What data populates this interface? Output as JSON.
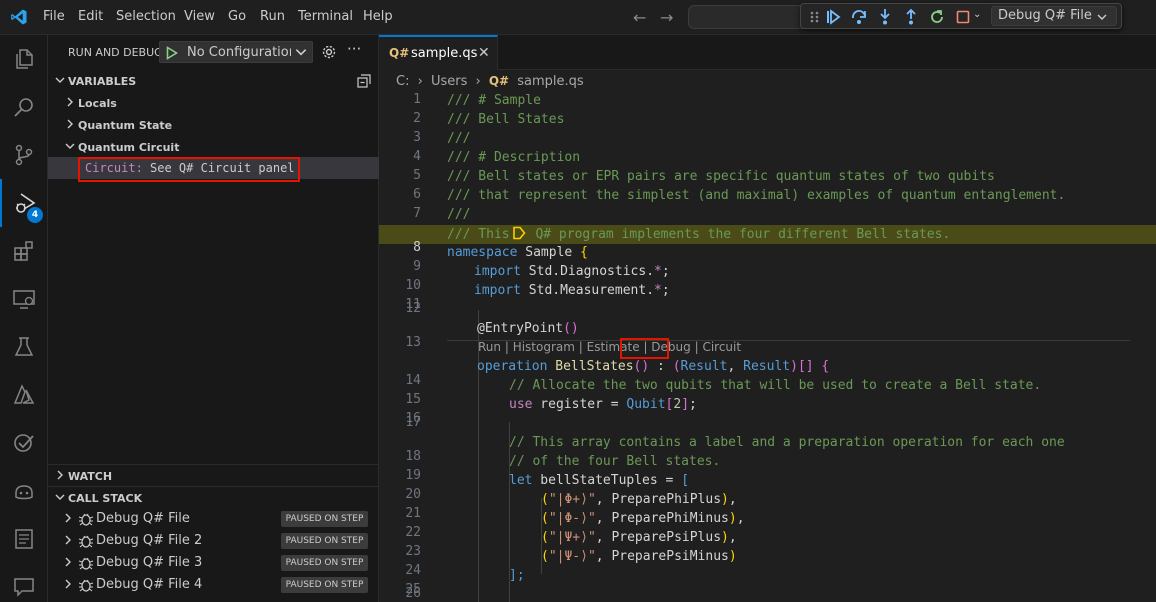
{
  "menu": {
    "items": [
      "File",
      "Edit",
      "Selection",
      "View",
      "Go",
      "Run",
      "Terminal",
      "Help"
    ]
  },
  "debug_toolbar": {
    "config_label": "Debug Q# File",
    "buttons": [
      "drag-handle-icon",
      "continue-icon",
      "step-over-icon",
      "step-into-icon",
      "step-out-icon",
      "restart-icon",
      "stop-icon"
    ]
  },
  "activity_bar": {
    "items": [
      "explorer-icon",
      "search-icon",
      "source-control-icon",
      "run-debug-icon",
      "extensions-icon",
      "remote-explorer-icon",
      "testing-icon",
      "azure-icon",
      "copilot-check-icon",
      "copilot-icon",
      "notes-icon",
      "chat-icon"
    ],
    "debug_badge": "4"
  },
  "sidebar": {
    "title": "RUN AND DEBUG",
    "config": "No Configurations",
    "variables": {
      "header": "VARIABLES",
      "groups": [
        "Locals",
        "Quantum State",
        "Quantum Circuit"
      ],
      "circuit_key": "Circuit:",
      "circuit_value": " See Q# Circuit panel"
    },
    "watch_header": "WATCH",
    "call_stack": {
      "header": "CALL STACK",
      "items": [
        {
          "name": "Debug Q# File",
          "status": "PAUSED ON STEP"
        },
        {
          "name": "Debug Q# File 2",
          "status": "PAUSED ON STEP"
        },
        {
          "name": "Debug Q# File 3",
          "status": "PAUSED ON STEP"
        },
        {
          "name": "Debug Q# File 4",
          "status": "PAUSED ON STEP"
        }
      ]
    }
  },
  "editor": {
    "tab": {
      "badge": "Q#",
      "name": "sample.qs"
    },
    "breadcrumb": {
      "drive": "C:",
      "sep": "›",
      "folder": "Users",
      "badge": "Q#",
      "file": "sample.qs"
    },
    "line_numbers": [
      "1",
      "2",
      "3",
      "4",
      "5",
      "6",
      "7",
      "8",
      "9",
      "10",
      "11",
      "12",
      "13",
      "14",
      "15",
      "16",
      "17",
      "18",
      "19",
      "20",
      "21",
      "22",
      "23",
      "24",
      "25",
      "26"
    ],
    "codelens": {
      "run": "Run",
      "histogram": "Histogram",
      "estimate": "Estimate",
      "debug": "Debug",
      "circuit": "Circuit",
      "sep": " | "
    },
    "tokens": {
      "l1": "/// # Sample",
      "l2": "/// Bell States",
      "l3": "///",
      "l4": "/// # Description",
      "l5": "/// Bell states or EPR pairs are specific quantum states of two qubits",
      "l6": "/// that represent the simplest (and maximal) examples of quantum entanglement.",
      "l7": "///",
      "l8a": "/// This",
      "l8b": " Q# program implements the four different Bell states.",
      "namespace": "namespace",
      "sample": " Sample ",
      "open_brace": "{",
      "import": "import",
      "diag": " Std.Diagnostics.",
      "meas": " Std.Measurement.",
      "star": "*",
      "semi": ";",
      "entry": "@EntryPoint",
      "parens": "()",
      "operation": "operation",
      "bellstates": " BellStates",
      "colon": " : ",
      "result": "Result",
      "comma": ", ",
      "arr": "[] {",
      "l15": "// Allocate the two qubits that will be used to create a Bell state.",
      "use": "use",
      "register": " register = ",
      "qubit": "Qubit",
      "two": "2",
      "l18": "// This array contains a label and a preparation operation for each one",
      "l19": "// of the four Bell states.",
      "let": "let",
      "tuples": " bellStateTuples = ",
      "open_bracket": "[",
      "s1": "\"|Φ+⟩\"",
      "s2": "\"|Φ-⟩\"",
      "s3": "\"|Ψ+⟩\"",
      "s4": "\"|Ψ-⟩\"",
      "p1": "PreparePhiPlus",
      "p2": "PreparePhiMinus",
      "p3": "PreparePsiPlus",
      "p4": "PreparePsiMinus",
      "close_arr": "];"
    }
  }
}
